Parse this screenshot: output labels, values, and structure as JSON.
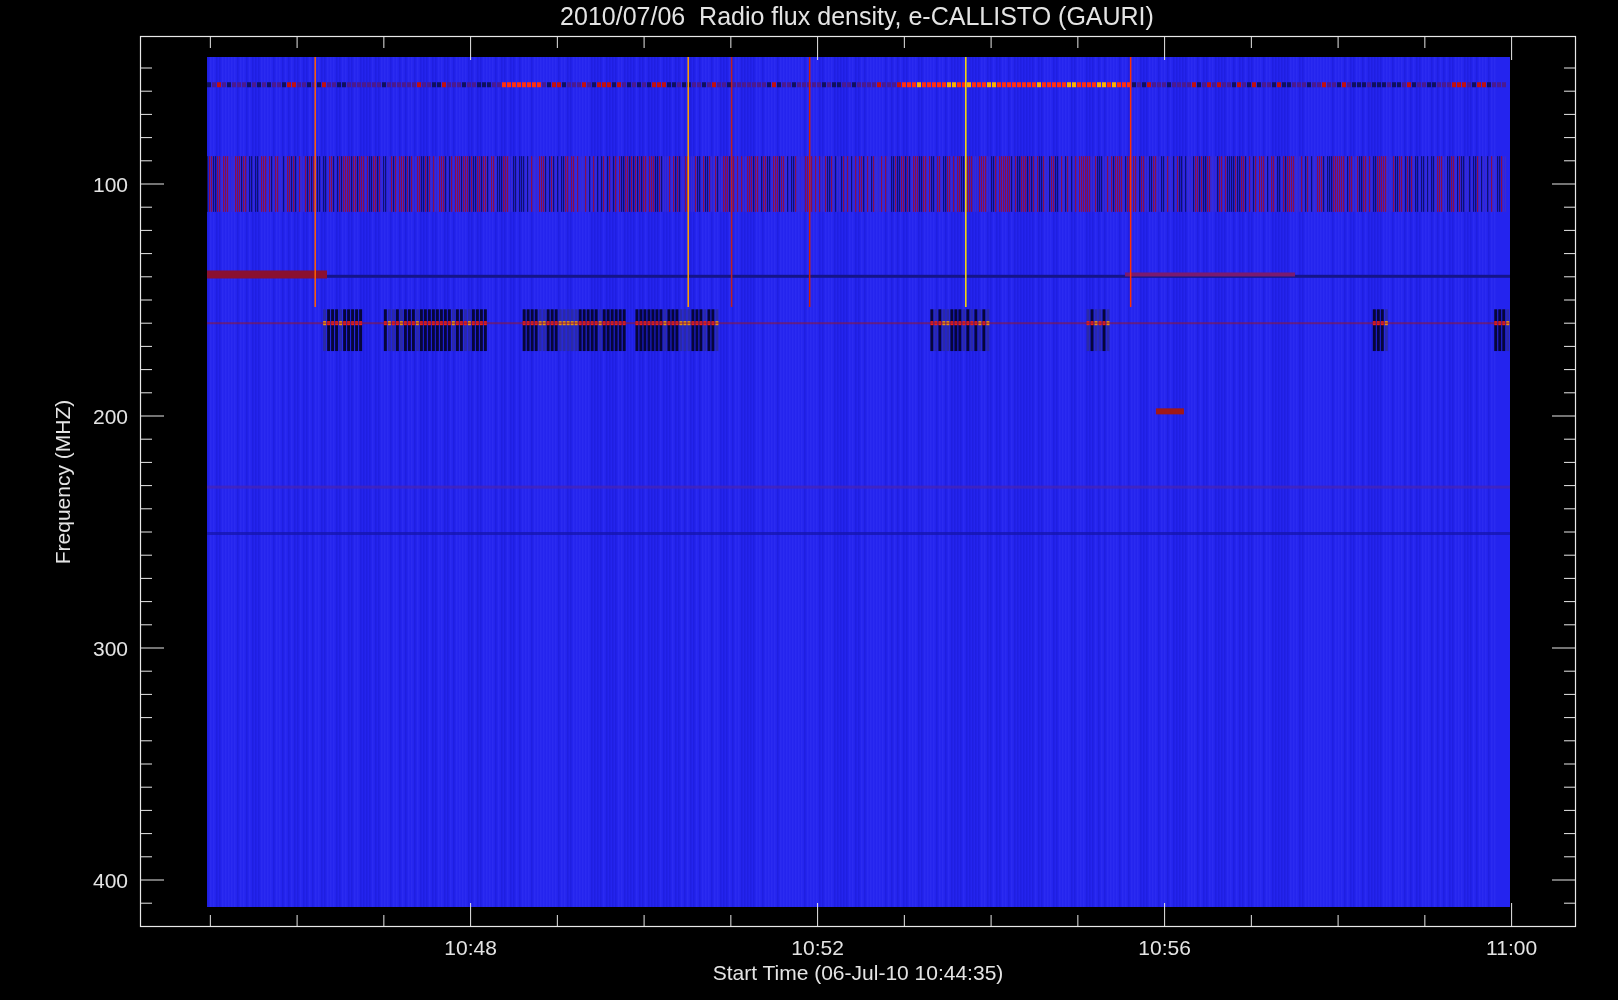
{
  "title": "2010/07/06  Radio flux density, e-CALLISTO (GAURI)",
  "y_axis": {
    "label": "Frequency (MHZ)",
    "ticks": [
      "100",
      "200",
      "300",
      "400"
    ]
  },
  "x_axis": {
    "label": "Start Time (06-Jul-10 10:44:35)",
    "ticks": [
      "10:48",
      "10:52",
      "10:56",
      "11:00"
    ]
  }
}
